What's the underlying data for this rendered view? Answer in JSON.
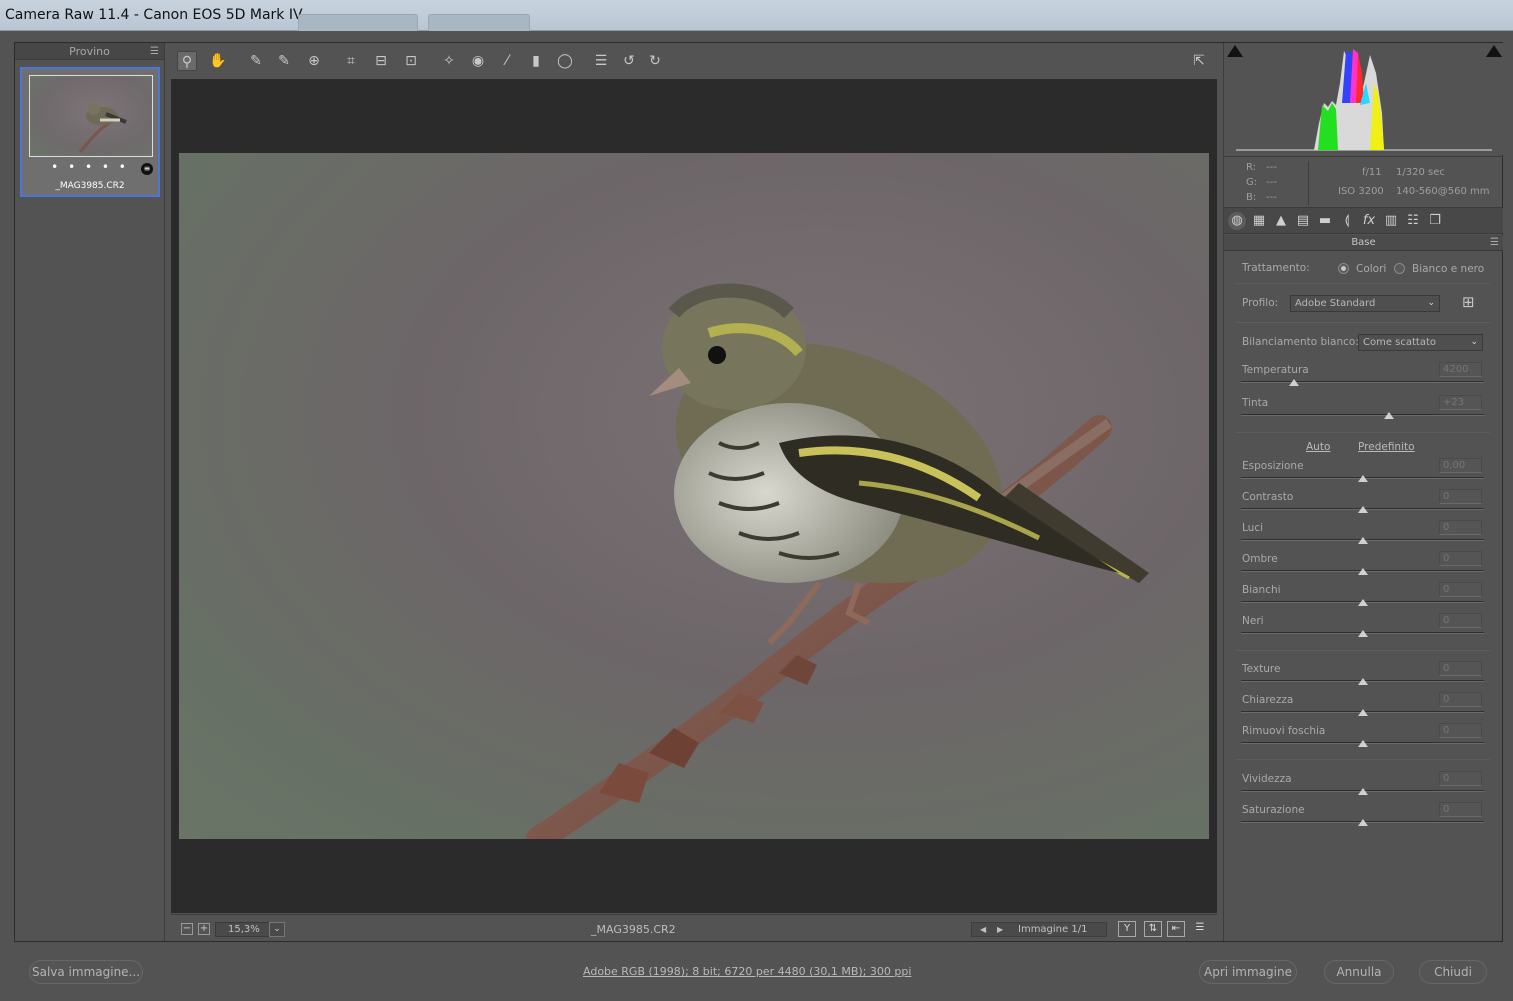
{
  "window": {
    "title": "Camera Raw 11.4  -  Canon EOS 5D Mark IV"
  },
  "filmstrip": {
    "header": "Provino",
    "thumbnail": {
      "filename": "_MAG3985.CR2",
      "rating_dots": "• • • • •"
    }
  },
  "toolbar": {
    "tools": [
      {
        "name": "zoom-tool",
        "glyph": "⚲"
      },
      {
        "name": "hand-tool",
        "glyph": "✋"
      },
      {
        "name": "white-balance-tool",
        "glyph": "✎"
      },
      {
        "name": "color-sampler-tool",
        "glyph": "✎"
      },
      {
        "name": "targeted-adjustment-tool",
        "glyph": "⊕"
      },
      {
        "name": "crop-tool",
        "glyph": "⌗"
      },
      {
        "name": "straighten-tool",
        "glyph": "⊟"
      },
      {
        "name": "transform-tool",
        "glyph": "⊡"
      },
      {
        "name": "spot-removal-tool",
        "glyph": "✧"
      },
      {
        "name": "red-eye-tool",
        "glyph": "◉"
      },
      {
        "name": "adjustment-brush-tool",
        "glyph": "⁄"
      },
      {
        "name": "graduated-filter-tool",
        "glyph": "▮"
      },
      {
        "name": "radial-filter-tool",
        "glyph": "◯"
      },
      {
        "name": "preferences-tool",
        "glyph": "☰"
      },
      {
        "name": "rotate-left-tool",
        "glyph": "↺"
      },
      {
        "name": "rotate-right-tool",
        "glyph": "↻"
      }
    ],
    "fullscreen_glyph": "⇱"
  },
  "statusbar": {
    "zoom_minus": "−",
    "zoom_plus": "+",
    "zoom_value": "15,3%",
    "filename": "_MAG3985.CR2",
    "image_counter": "Immagine 1/1"
  },
  "histogram": {
    "readout": {
      "r_label": "R:",
      "r_value": "---",
      "g_label": "G:",
      "g_value": "---",
      "b_label": "B:",
      "b_value": "---",
      "aperture": "f/11",
      "shutter": "1/320 sec",
      "iso": "ISO 3200",
      "lens": "140-560@560 mm"
    }
  },
  "panel": {
    "section_title": "Base",
    "trattamento_label": "Trattamento:",
    "trattamento_options": [
      "Colori",
      "Bianco e nero"
    ],
    "profilo_label": "Profilo:",
    "profilo_value": "Adobe Standard",
    "wb_label": "Bilanciamento bianco:",
    "wb_value": "Come scattato",
    "auto_link": "Auto",
    "default_link": "Predefinito",
    "sliders": [
      {
        "label": "Temperatura",
        "value": "4200",
        "position": 0.22
      },
      {
        "label": "Tinta",
        "value": "+23",
        "position": 0.61
      },
      {
        "label": "Esposizione",
        "value": "0,00",
        "position": 0.5
      },
      {
        "label": "Contrasto",
        "value": "0",
        "position": 0.5
      },
      {
        "label": "Luci",
        "value": "0",
        "position": 0.5
      },
      {
        "label": "Ombre",
        "value": "0",
        "position": 0.5
      },
      {
        "label": "Bianchi",
        "value": "0",
        "position": 0.5
      },
      {
        "label": "Neri",
        "value": "0",
        "position": 0.5
      },
      {
        "label": "Texture",
        "value": "0",
        "position": 0.5
      },
      {
        "label": "Chiarezza",
        "value": "0",
        "position": 0.5
      },
      {
        "label": "Rimuovi foschia",
        "value": "0",
        "position": 0.5
      },
      {
        "label": "Vividezza",
        "value": "0",
        "position": 0.5
      },
      {
        "label": "Saturazione",
        "value": "0",
        "position": 0.5
      }
    ]
  },
  "bottom": {
    "save_label": "Salva immagine...",
    "info_text": "Adobe RGB (1998); 8 bit; 6720 per 4480 (30,1 MB); 300 ppi",
    "open_label": "Apri immagine",
    "cancel_label": "Annulla",
    "close_label": "Chiudi"
  },
  "colors": {
    "selection_blue": "#4b78d8",
    "panel_bg": "#535353",
    "canvas_bg": "#2b2b2b"
  }
}
